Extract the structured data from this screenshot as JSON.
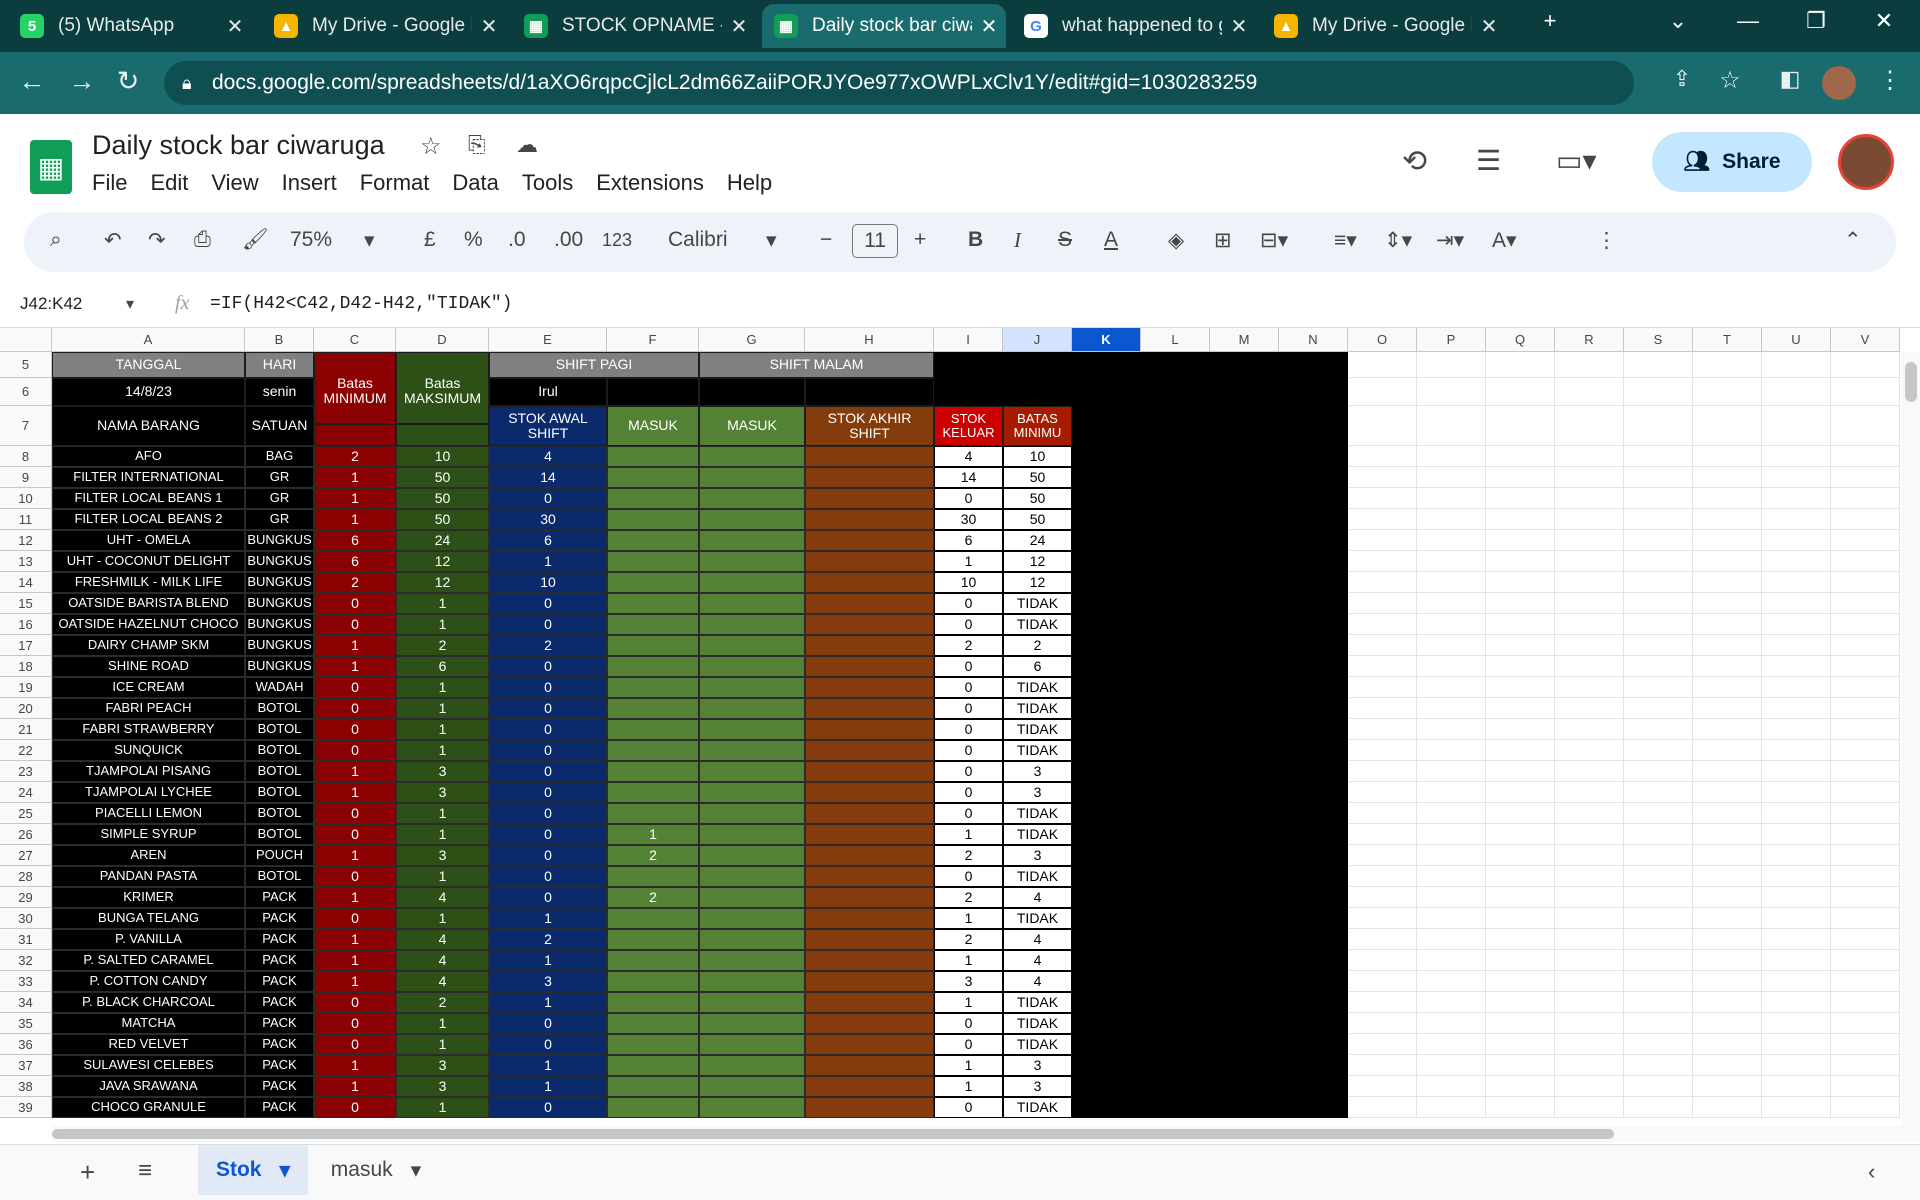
{
  "browser": {
    "tabs": [
      {
        "title": "(5) WhatsApp",
        "favicon": "whatsapp-icon",
        "color": "#25d366",
        "glyph": "5"
      },
      {
        "title": "My Drive - Google D",
        "favicon": "drive-icon",
        "color": "#f4b400",
        "glyph": "▲"
      },
      {
        "title": "STOCK OPNAME - G",
        "favicon": "sheets-icon",
        "color": "#0f9d58",
        "glyph": "▦"
      },
      {
        "title": "Daily stock bar ciwa",
        "favicon": "sheets-icon",
        "color": "#0f9d58",
        "glyph": "▦"
      },
      {
        "title": "what happened to g",
        "favicon": "google-icon",
        "color": "#ffffff",
        "glyph": "G"
      },
      {
        "title": "My Drive - Google D",
        "favicon": "drive-icon",
        "color": "#f4b400",
        "glyph": "▲"
      }
    ],
    "url": "docs.google.com/spreadsheets/d/1aXO6rqpcCjlcL2dm66ZaiiPORJYOe977xOWPLxClv1Y/edit#gid=1030283259"
  },
  "doc": {
    "title": "Daily stock bar ciwaruga",
    "menu": [
      "File",
      "Edit",
      "View",
      "Insert",
      "Format",
      "Data",
      "Tools",
      "Extensions",
      "Help"
    ],
    "share": "Share"
  },
  "toolbar": {
    "zoom": "75%",
    "currency": "£",
    "percent": "%",
    "dec_less": ".0",
    "dec_more": ".00",
    "format": "123",
    "font": "Calibri",
    "size": "11"
  },
  "formula": {
    "ref": "J42:K42",
    "fx": "fx",
    "text": "=IF(H42<C42,D42-H42,\"TIDAK\")"
  },
  "columns": [
    "A",
    "B",
    "C",
    "D",
    "E",
    "F",
    "G",
    "H",
    "I",
    "J",
    "K",
    "L",
    "M",
    "N",
    "O",
    "P",
    "Q",
    "R",
    "S",
    "T",
    "U",
    "V"
  ],
  "header": {
    "tanggal": "TANGGAL",
    "hari": "HARI",
    "batas_min": "Batas MINIMUM",
    "batas_max": "Batas MAKSIMUM",
    "shift_pagi": "SHIFT PAGI",
    "shift_malam": "SHIFT MALAM",
    "date": "14/8/23",
    "day": "senin",
    "staff": "Irul",
    "nama": "NAMA BARANG",
    "satuan": "SATUAN",
    "stok_awal": "STOK AWAL SHIFT",
    "masuk": "MASUK",
    "masuk2": "MASUK",
    "stok_akhir": "STOK AKHIR SHIFT",
    "stok_keluar": "STOK KELUAR",
    "batas_minimu": "BATAS MINIMU"
  },
  "rows": [
    {
      "n": "8",
      "name": "AFO",
      "unit": "BAG",
      "min": "2",
      "max": "10",
      "awal": "4",
      "masuk": "",
      "keluar": "4",
      "batas": "10"
    },
    {
      "n": "9",
      "name": "FILTER INTERNATIONAL",
      "unit": "GR",
      "min": "1",
      "max": "50",
      "awal": "14",
      "masuk": "",
      "keluar": "14",
      "batas": "50"
    },
    {
      "n": "10",
      "name": "FILTER LOCAL BEANS 1",
      "unit": "GR",
      "min": "1",
      "max": "50",
      "awal": "0",
      "masuk": "",
      "keluar": "0",
      "batas": "50"
    },
    {
      "n": "11",
      "name": "FILTER LOCAL BEANS 2",
      "unit": "GR",
      "min": "1",
      "max": "50",
      "awal": "30",
      "masuk": "",
      "keluar": "30",
      "batas": "50"
    },
    {
      "n": "12",
      "name": "UHT - OMELA",
      "unit": "BUNGKUS",
      "min": "6",
      "max": "24",
      "awal": "6",
      "masuk": "",
      "keluar": "6",
      "batas": "24"
    },
    {
      "n": "13",
      "name": "UHT - COCONUT DELIGHT",
      "unit": "BUNGKUS",
      "min": "6",
      "max": "12",
      "awal": "1",
      "masuk": "",
      "keluar": "1",
      "batas": "12"
    },
    {
      "n": "14",
      "name": "FRESHMILK - MILK LIFE",
      "unit": "BUNGKUS",
      "min": "2",
      "max": "12",
      "awal": "10",
      "masuk": "",
      "keluar": "10",
      "batas": "12"
    },
    {
      "n": "15",
      "name": "OATSIDE BARISTA BLEND",
      "unit": "BUNGKUS",
      "min": "0",
      "max": "1",
      "awal": "0",
      "masuk": "",
      "keluar": "0",
      "batas": "TIDAK"
    },
    {
      "n": "16",
      "name": "OATSIDE HAZELNUT CHOCO",
      "unit": "BUNGKUS",
      "min": "0",
      "max": "1",
      "awal": "0",
      "masuk": "",
      "keluar": "0",
      "batas": "TIDAK"
    },
    {
      "n": "17",
      "name": "DAIRY CHAMP SKM",
      "unit": "BUNGKUS",
      "min": "1",
      "max": "2",
      "awal": "2",
      "masuk": "",
      "keluar": "2",
      "batas": "2"
    },
    {
      "n": "18",
      "name": "SHINE ROAD",
      "unit": "BUNGKUS",
      "min": "1",
      "max": "6",
      "awal": "0",
      "masuk": "",
      "keluar": "0",
      "batas": "6"
    },
    {
      "n": "19",
      "name": "ICE CREAM",
      "unit": "WADAH",
      "min": "0",
      "max": "1",
      "awal": "0",
      "masuk": "",
      "keluar": "0",
      "batas": "TIDAK"
    },
    {
      "n": "20",
      "name": "FABRI PEACH",
      "unit": "BOTOL",
      "min": "0",
      "max": "1",
      "awal": "0",
      "masuk": "",
      "keluar": "0",
      "batas": "TIDAK"
    },
    {
      "n": "21",
      "name": "FABRI STRAWBERRY",
      "unit": "BOTOL",
      "min": "0",
      "max": "1",
      "awal": "0",
      "masuk": "",
      "keluar": "0",
      "batas": "TIDAK"
    },
    {
      "n": "22",
      "name": "SUNQUICK",
      "unit": "BOTOL",
      "min": "0",
      "max": "1",
      "awal": "0",
      "masuk": "",
      "keluar": "0",
      "batas": "TIDAK"
    },
    {
      "n": "23",
      "name": "TJAMPOLAI PISANG",
      "unit": "BOTOL",
      "min": "1",
      "max": "3",
      "awal": "0",
      "masuk": "",
      "keluar": "0",
      "batas": "3"
    },
    {
      "n": "24",
      "name": "TJAMPOLAI LYCHEE",
      "unit": "BOTOL",
      "min": "1",
      "max": "3",
      "awal": "0",
      "masuk": "",
      "keluar": "0",
      "batas": "3"
    },
    {
      "n": "25",
      "name": "PIACELLI LEMON",
      "unit": "BOTOL",
      "min": "0",
      "max": "1",
      "awal": "0",
      "masuk": "",
      "keluar": "0",
      "batas": "TIDAK"
    },
    {
      "n": "26",
      "name": "SIMPLE SYRUP",
      "unit": "BOTOL",
      "min": "0",
      "max": "1",
      "awal": "0",
      "masuk": "1",
      "keluar": "1",
      "batas": "TIDAK"
    },
    {
      "n": "27",
      "name": "AREN",
      "unit": "POUCH",
      "min": "1",
      "max": "3",
      "awal": "0",
      "masuk": "2",
      "keluar": "2",
      "batas": "3"
    },
    {
      "n": "28",
      "name": "PANDAN PASTA",
      "unit": "BOTOL",
      "min": "0",
      "max": "1",
      "awal": "0",
      "masuk": "",
      "keluar": "0",
      "batas": "TIDAK"
    },
    {
      "n": "29",
      "name": "KRIMER",
      "unit": "PACK",
      "min": "1",
      "max": "4",
      "awal": "0",
      "masuk": "2",
      "keluar": "2",
      "batas": "4"
    },
    {
      "n": "30",
      "name": "BUNGA TELANG",
      "unit": "PACK",
      "min": "0",
      "max": "1",
      "awal": "1",
      "masuk": "",
      "keluar": "1",
      "batas": "TIDAK"
    },
    {
      "n": "31",
      "name": "P. VANILLA",
      "unit": "PACK",
      "min": "1",
      "max": "4",
      "awal": "2",
      "masuk": "",
      "keluar": "2",
      "batas": "4"
    },
    {
      "n": "32",
      "name": "P. SALTED CARAMEL",
      "unit": "PACK",
      "min": "1",
      "max": "4",
      "awal": "1",
      "masuk": "",
      "keluar": "1",
      "batas": "4"
    },
    {
      "n": "33",
      "name": "P. COTTON CANDY",
      "unit": "PACK",
      "min": "1",
      "max": "4",
      "awal": "3",
      "masuk": "",
      "keluar": "3",
      "batas": "4"
    },
    {
      "n": "34",
      "name": "P. BLACK CHARCOAL",
      "unit": "PACK",
      "min": "0",
      "max": "2",
      "awal": "1",
      "masuk": "",
      "keluar": "1",
      "batas": "TIDAK"
    },
    {
      "n": "35",
      "name": "MATCHA",
      "unit": "PACK",
      "min": "0",
      "max": "1",
      "awal": "0",
      "masuk": "",
      "keluar": "0",
      "batas": "TIDAK"
    },
    {
      "n": "36",
      "name": "RED VELVET",
      "unit": "PACK",
      "min": "0",
      "max": "1",
      "awal": "0",
      "masuk": "",
      "keluar": "0",
      "batas": "TIDAK"
    },
    {
      "n": "37",
      "name": "SULAWESI CELEBES",
      "unit": "PACK",
      "min": "1",
      "max": "3",
      "awal": "1",
      "masuk": "",
      "keluar": "1",
      "batas": "3"
    },
    {
      "n": "38",
      "name": "JAVA SRAWANA",
      "unit": "PACK",
      "min": "1",
      "max": "3",
      "awal": "1",
      "masuk": "",
      "keluar": "1",
      "batas": "3"
    },
    {
      "n": "39",
      "name": "CHOCO GRANULE",
      "unit": "PACK",
      "min": "0",
      "max": "1",
      "awal": "0",
      "masuk": "",
      "keluar": "0",
      "batas": "TIDAK"
    }
  ],
  "sheets": [
    {
      "name": "Stok",
      "active": true
    },
    {
      "name": "masuk",
      "active": false
    }
  ],
  "colors": {
    "min": "#8b0000",
    "max": "#2d5016",
    "awal": "#0b2a6b",
    "masuk": "#548235",
    "akhir": "#843c0c",
    "keluar_head": "#cc0000",
    "batas_head": "#a61c00",
    "header_grey": "#808080"
  }
}
